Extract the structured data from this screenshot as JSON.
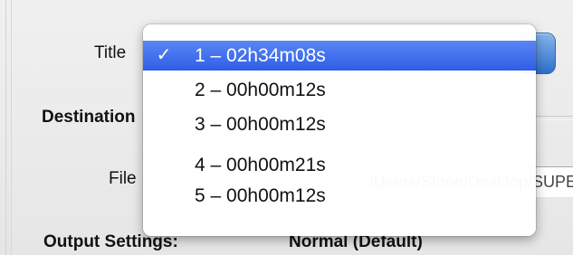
{
  "form": {
    "title_label": "Title",
    "destination_label": "Destination",
    "file_label": "File",
    "file_path": "/Users/Stone/Desktop/SUPE",
    "output_settings_label": "Output Settings:",
    "output_settings_value": "Normal (Default)"
  },
  "title_menu": {
    "selected_index": 0,
    "check_glyph": "✓",
    "items": [
      {
        "label": "1 – 02h34m08s"
      },
      {
        "label": "2 – 00h00m12s"
      },
      {
        "label": "3 – 00h00m12s"
      },
      {
        "label": "4 – 00h00m21s"
      },
      {
        "label": "5 – 00h00m12s"
      }
    ]
  },
  "colors": {
    "selection": "#3a6cee",
    "popup_button": "#4d8ae0"
  }
}
